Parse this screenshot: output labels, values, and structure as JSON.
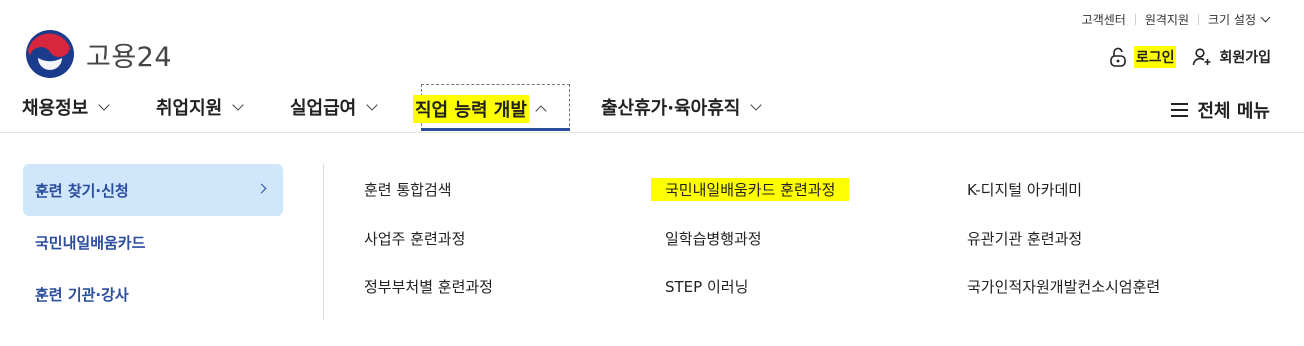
{
  "utility": {
    "items": [
      "고객센터",
      "원격지원",
      "크기 설정"
    ]
  },
  "logo": {
    "text": "고용24"
  },
  "auth": {
    "login": "로그인",
    "signup": "회원가입"
  },
  "gnb": {
    "items": [
      "채용정보",
      "취업지원",
      "실업급여",
      "직업 능력 개발",
      "출산휴가·육아휴직"
    ],
    "active_index": 3,
    "all_menu": "전체 메뉴"
  },
  "submenu": {
    "side": [
      "훈련 찾기·신청",
      "국민내일배움카드",
      "훈련 기관·강사"
    ],
    "side_active_index": 0,
    "links": [
      [
        "훈련 통합검색",
        "국민내일배움카드 훈련과정",
        "K-디지털 아카데미"
      ],
      [
        "사업주 훈련과정",
        "일학습병행과정",
        "유관기관 훈련과정"
      ],
      [
        "정부부처별 훈련과정",
        "STEP 이러닝",
        "국가인적자원개발컨소시엄훈련"
      ]
    ]
  },
  "colors": {
    "accent": "#2a4d9e",
    "side_active_bg": "#cfe6fb",
    "highlight": "#ffff00"
  }
}
